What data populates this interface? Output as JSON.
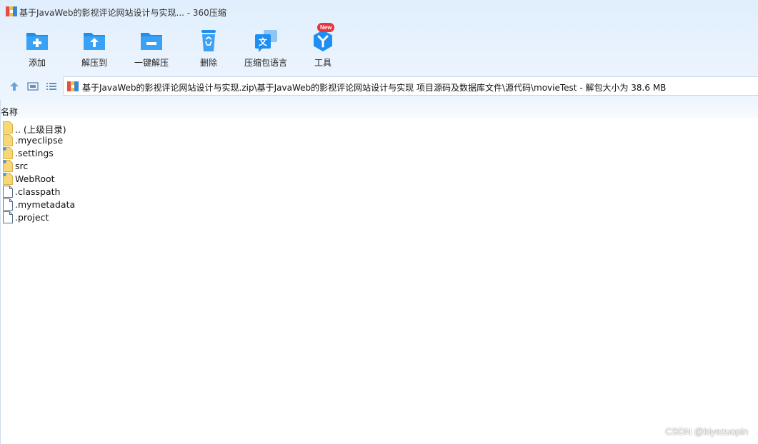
{
  "window": {
    "title": "基于JavaWeb的影视评论网站设计与实现... - 360压缩",
    "app_icon": "archive-app-icon"
  },
  "toolbar": {
    "items": [
      {
        "label": "添加",
        "icon": "add-folder-icon"
      },
      {
        "label": "解压到",
        "icon": "extract-to-icon"
      },
      {
        "label": "一键解压",
        "icon": "one-click-extract-icon"
      },
      {
        "label": "删除",
        "icon": "recycle-bin-icon"
      },
      {
        "label": "压缩包语言",
        "icon": "language-icon"
      },
      {
        "label": "工具",
        "icon": "tools-icon",
        "badge": "New"
      }
    ]
  },
  "nav": {
    "up_icon": "up-arrow-icon",
    "view_icon": "thumbnail-view-icon",
    "list_icon": "list-view-icon",
    "path": "基于JavaWeb的影视评论网站设计与实现.zip\\基于JavaWeb的影视评论网站设计与实现 项目源码及数据库文件\\源代码\\movieTest - 解包大小为 38.6 MB"
  },
  "list": {
    "column_name": "名称",
    "items": [
      {
        "name": ".. (上级目录)",
        "type": "folder"
      },
      {
        "name": ".myeclipse",
        "type": "folder"
      },
      {
        "name": ".settings",
        "type": "folder"
      },
      {
        "name": "src",
        "type": "folder"
      },
      {
        "name": "WebRoot",
        "type": "folder"
      },
      {
        "name": ".classpath",
        "type": "file"
      },
      {
        "name": ".mymetadata",
        "type": "file"
      },
      {
        "name": ".project",
        "type": "file"
      }
    ]
  },
  "watermark": "CSDN @biyezuopin",
  "colors": {
    "accent_blue": "#1e8ff0",
    "chrome_bg": "#e3effd",
    "folder_yellow": "#f8d775",
    "badge_red": "#e8343d"
  }
}
